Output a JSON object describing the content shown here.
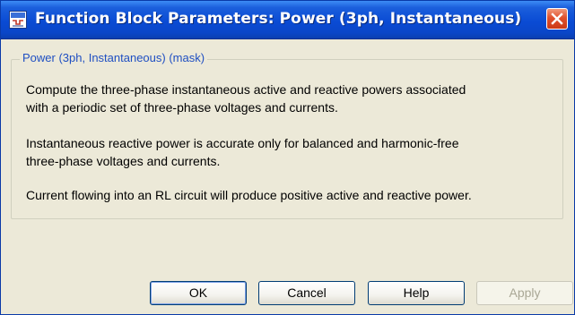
{
  "window": {
    "title": "Function Block Parameters: Power (3ph, Instantaneous)"
  },
  "mask": {
    "group_title": "Power (3ph, Instantaneous) (mask)",
    "description": [
      [
        "Compute the three-phase instantaneous active and reactive powers associated",
        "with a periodic set of three-phase voltages and currents."
      ],
      [
        "Instantaneous reactive power is accurate only for balanced and harmonic-free",
        "three-phase voltages and currents."
      ],
      [
        "Current flowing into an RL circuit will produce positive active and reactive power."
      ]
    ]
  },
  "buttons": {
    "ok": "OK",
    "cancel": "Cancel",
    "help": "Help",
    "apply": "Apply"
  },
  "icons": {
    "app": "simulink-block-icon",
    "close": "close-icon"
  },
  "colors": {
    "titlebar": "#0a4bd4",
    "group_title": "#1f4fc2",
    "close_button": "#e0502c"
  }
}
